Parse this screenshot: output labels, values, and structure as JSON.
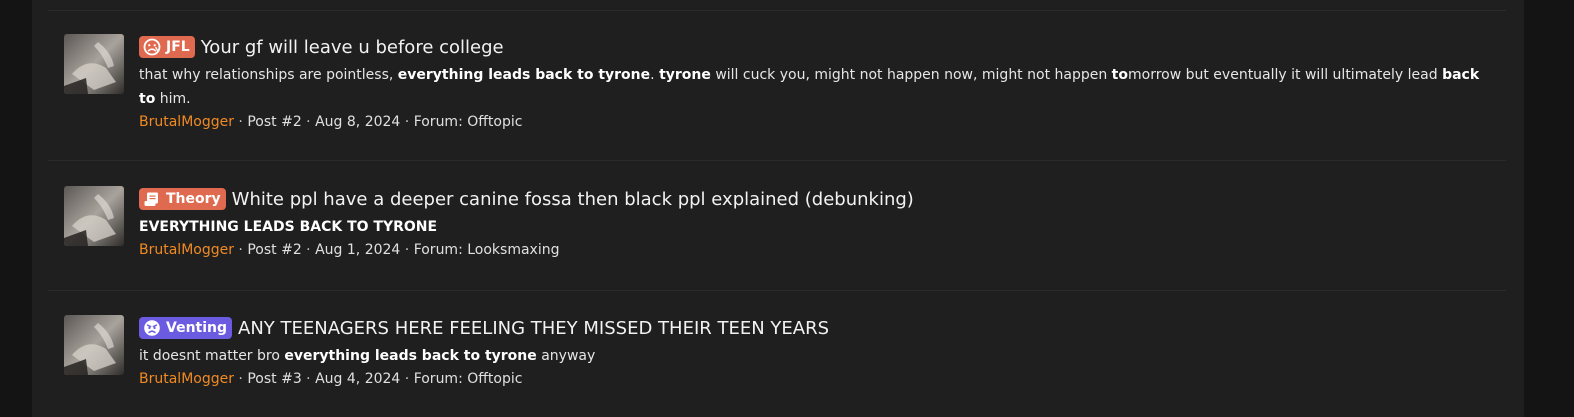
{
  "colors": {
    "page_bg": "#141414",
    "panel_bg": "#1f1f1f",
    "username": "#f08a24",
    "prefix_jfl": "#e06a4f",
    "prefix_theory": "#e06a4f",
    "prefix_venting": "#6a5be0"
  },
  "results": [
    {
      "prefix": {
        "label": "JFL",
        "icon": "sad-face-icon"
      },
      "title": "Your gf will leave u before college",
      "snippet": {
        "parts": [
          {
            "text": "that why relationships are pointless, ",
            "bold": false
          },
          {
            "text": "everything leads back to tyrone",
            "bold": true
          },
          {
            "text": ". ",
            "bold": false
          },
          {
            "text": "tyrone",
            "bold": true
          },
          {
            "text": " will cuck you, might not happen now, might not happen ",
            "bold": false
          },
          {
            "text": "to",
            "bold": true
          },
          {
            "text": "morrow but eventually it will ultimately lead ",
            "bold": false
          },
          {
            "text": "back to",
            "bold": true
          },
          {
            "text": " him.",
            "bold": false
          }
        ]
      },
      "meta": {
        "user": "BrutalMogger",
        "post": "Post #2",
        "date": "Aug 8, 2024",
        "forum": "Forum: Offtopic"
      }
    },
    {
      "prefix": {
        "label": "Theory",
        "icon": "scroll-icon"
      },
      "title": "White ppl have a deeper canine fossa then black ppl explained (debunking)",
      "snippet": {
        "parts": [
          {
            "text": "EVERYTHING LEADS BACK TO TYRONE",
            "bold": true
          }
        ]
      },
      "meta": {
        "user": "BrutalMogger",
        "post": "Post #2",
        "date": "Aug 1, 2024",
        "forum": "Forum: Looksmaxing"
      }
    },
    {
      "prefix": {
        "label": "Venting",
        "icon": "angry-face-icon"
      },
      "title": "ANY TEENAGERS HERE FEELING THEY MISSED THEIR TEEN YEARS",
      "snippet": {
        "parts": [
          {
            "text": "it doesnt matter bro ",
            "bold": false
          },
          {
            "text": "everything leads back to tyrone",
            "bold": true
          },
          {
            "text": " anyway",
            "bold": false
          }
        ]
      },
      "meta": {
        "user": "BrutalMogger",
        "post": "Post #3",
        "date": "Aug 4, 2024",
        "forum": "Forum: Offtopic"
      }
    }
  ],
  "separator": " · "
}
